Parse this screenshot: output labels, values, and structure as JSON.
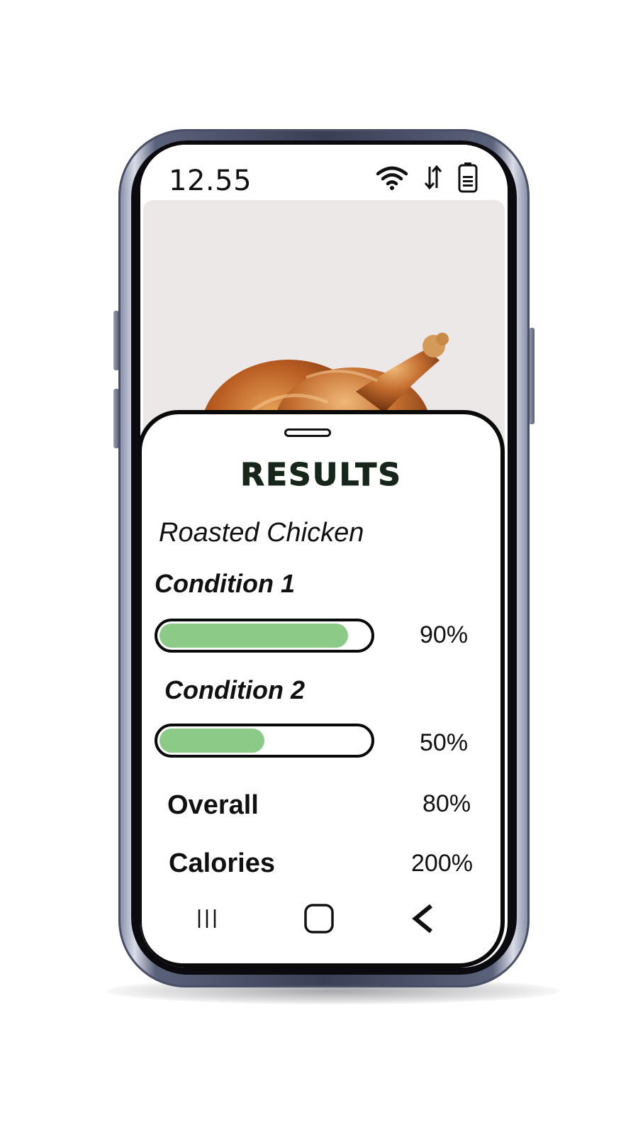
{
  "status_bar": {
    "time": "12.55",
    "icons": [
      "wifi-icon",
      "data-transfer-icon",
      "battery-icon"
    ]
  },
  "photo": {
    "subject": "roasted-chicken-image"
  },
  "results": {
    "title": "RESULTS",
    "food_name": "Roasted Chicken",
    "conditions": [
      {
        "label": "Condition 1",
        "percent_text": "90%",
        "value": 0.9
      },
      {
        "label": "Condition 2",
        "percent_text": "50%",
        "value": 0.5
      }
    ],
    "overall": {
      "label": "Overall",
      "value": "80%"
    },
    "calories": {
      "label": "Calories",
      "value": "200%"
    }
  },
  "nav_bar": {
    "items": [
      "recent-apps-icon",
      "home-icon",
      "back-icon"
    ]
  },
  "colors": {
    "bar_fill": "#8cca87",
    "title_color": "#16261a",
    "photo_bg": "#ede8e8"
  }
}
